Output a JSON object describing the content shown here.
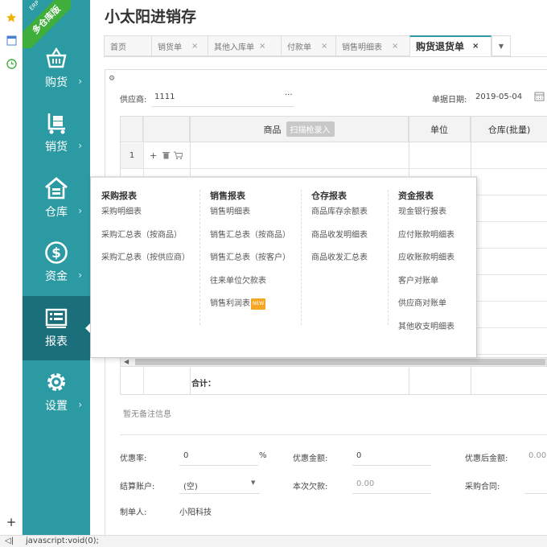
{
  "app": {
    "title": "小太阳进销存",
    "ribbon_text": "多仓库版",
    "ribbon_tag": "ERP"
  },
  "sidebar": {
    "items": [
      {
        "label": "购货",
        "icon": "basket-icon"
      },
      {
        "label": "销货",
        "icon": "trolley-icon"
      },
      {
        "label": "仓库",
        "icon": "warehouse-icon"
      },
      {
        "label": "资金",
        "icon": "dollar-coin-icon"
      },
      {
        "label": "报表",
        "icon": "report-icon",
        "active": true
      },
      {
        "label": "设置",
        "icon": "gear-icon"
      }
    ],
    "arrow": "›"
  },
  "tabs": [
    {
      "label": "首页",
      "closable": false
    },
    {
      "label": "销货单",
      "closable": true
    },
    {
      "label": "其他入库单",
      "closable": true
    },
    {
      "label": "付款单",
      "closable": true
    },
    {
      "label": "销售明细表",
      "closable": true
    },
    {
      "label": "购货退货单",
      "closable": true,
      "active": true
    }
  ],
  "tab_close": "×",
  "form": {
    "supplier_label": "供应商:",
    "supplier_value": "1111",
    "supplier_more": "···",
    "date_label": "单据日期:",
    "date_value": "2019-05-04"
  },
  "grid": {
    "headers": {
      "product": "商品",
      "scan_button": "扫描枪录入",
      "unit": "单位",
      "warehouse": "仓库(批量)"
    },
    "first_row_index": "1",
    "total_label": "合计：",
    "remark_placeholder": "暂无备注信息"
  },
  "footer": {
    "discount_rate_label": "优惠率:",
    "discount_rate_value": "0",
    "discount_rate_unit": "%",
    "discount_amount_label": "优惠金额:",
    "discount_amount_value": "0",
    "after_discount_label": "优惠后金额:",
    "after_discount_value": "0.00",
    "settlement_label": "结算账户:",
    "settlement_value": "(空)",
    "arrears_label": "本次欠款:",
    "arrears_value": "0.00",
    "contract_label": "采购合同:",
    "maker_label": "制单人:",
    "maker_value": "小阳科技"
  },
  "popup": {
    "columns": [
      {
        "title": "采购报表",
        "items": [
          "采购明细表",
          "采购汇总表（按商品）",
          "采购汇总表（按供应商）"
        ]
      },
      {
        "title": "销售报表",
        "items": [
          "销售明细表",
          "销售汇总表（按商品）",
          "销售汇总表（按客户）",
          "往来单位欠款表",
          "销售利润表"
        ],
        "badge_item": "销售利润表",
        "badge": "NEW"
      },
      {
        "title": "仓存报表",
        "items": [
          "商品库存余额表",
          "商品收发明细表",
          "商品收发汇总表"
        ]
      },
      {
        "title": "资金报表",
        "items": [
          "现金银行报表",
          "应付账款明细表",
          "应收账款明细表",
          "客户对账单",
          "供应商对账单",
          "其他收支明细表"
        ]
      }
    ]
  },
  "status_bar": {
    "text": "javascript:void(0);",
    "collapse_icon": "◁|"
  },
  "colors": {
    "sidebar": "#2b9aa3",
    "sidebar_active": "#1b6f7a",
    "ribbon": "#3fae3b",
    "badge": "#f5a623"
  }
}
